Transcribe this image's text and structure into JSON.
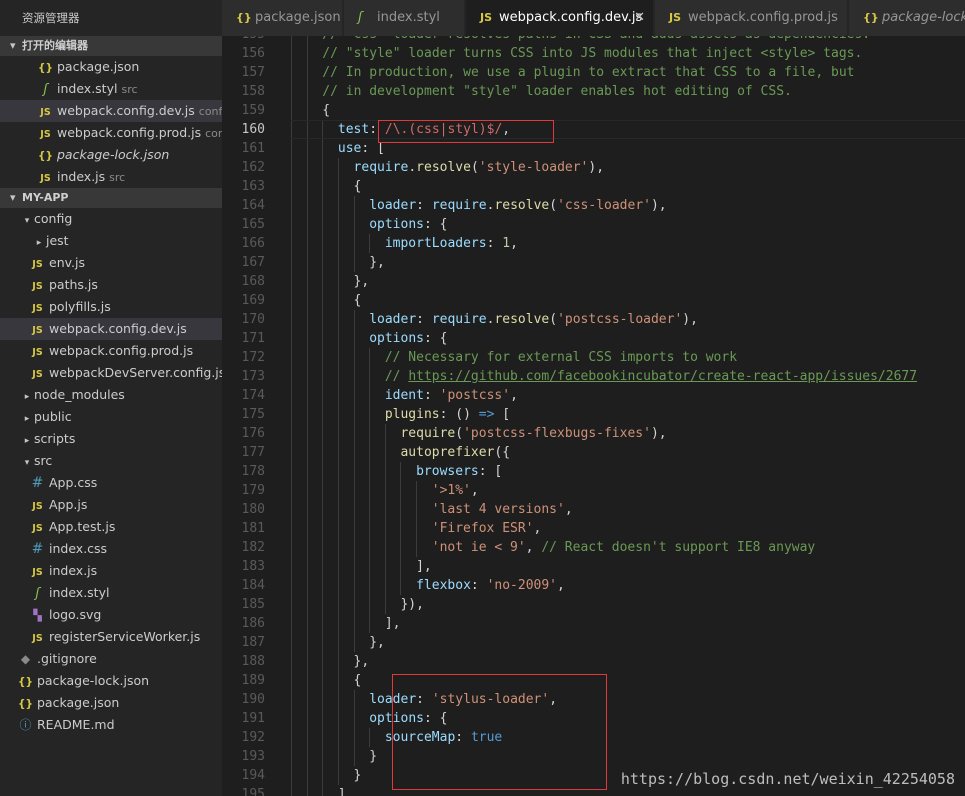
{
  "explorer": {
    "title": "资源管理器",
    "open_editors_label": "打开的编辑器",
    "open_editors": [
      {
        "name": "package.json",
        "icon": "json",
        "desc": "",
        "italic": false,
        "selected": false
      },
      {
        "name": "index.styl",
        "icon": "styl",
        "desc": "src",
        "italic": false,
        "selected": false
      },
      {
        "name": "webpack.config.dev.js",
        "icon": "js",
        "desc": "config",
        "italic": false,
        "selected": true
      },
      {
        "name": "webpack.config.prod.js",
        "icon": "js",
        "desc": "con...",
        "italic": false,
        "selected": false
      },
      {
        "name": "package-lock.json",
        "icon": "json",
        "desc": "",
        "italic": true,
        "selected": false
      },
      {
        "name": "index.js",
        "icon": "js",
        "desc": "src",
        "italic": false,
        "selected": false
      }
    ],
    "project_label": "MY-APP",
    "tree": [
      {
        "name": "config",
        "type": "folder-open",
        "depth": 1
      },
      {
        "name": "jest",
        "type": "folder",
        "depth": 2
      },
      {
        "name": "env.js",
        "type": "js",
        "depth": 2
      },
      {
        "name": "paths.js",
        "type": "js",
        "depth": 2
      },
      {
        "name": "polyfills.js",
        "type": "js",
        "depth": 2
      },
      {
        "name": "webpack.config.dev.js",
        "type": "js",
        "depth": 2,
        "selected": true
      },
      {
        "name": "webpack.config.prod.js",
        "type": "js",
        "depth": 2
      },
      {
        "name": "webpackDevServer.config.js",
        "type": "js",
        "depth": 2
      },
      {
        "name": "node_modules",
        "type": "folder",
        "depth": 1
      },
      {
        "name": "public",
        "type": "folder",
        "depth": 1
      },
      {
        "name": "scripts",
        "type": "folder",
        "depth": 1
      },
      {
        "name": "src",
        "type": "folder-open",
        "depth": 1
      },
      {
        "name": "App.css",
        "type": "css",
        "depth": 2
      },
      {
        "name": "App.js",
        "type": "js",
        "depth": 2
      },
      {
        "name": "App.test.js",
        "type": "js",
        "depth": 2
      },
      {
        "name": "index.css",
        "type": "css",
        "depth": 2
      },
      {
        "name": "index.js",
        "type": "js",
        "depth": 2
      },
      {
        "name": "index.styl",
        "type": "styl",
        "depth": 2
      },
      {
        "name": "logo.svg",
        "type": "svg",
        "depth": 2
      },
      {
        "name": "registerServiceWorker.js",
        "type": "js",
        "depth": 2
      },
      {
        "name": ".gitignore",
        "type": "git",
        "depth": 1
      },
      {
        "name": "package-lock.json",
        "type": "json",
        "depth": 1
      },
      {
        "name": "package.json",
        "type": "json",
        "depth": 1
      },
      {
        "name": "README.md",
        "type": "info",
        "depth": 1
      }
    ]
  },
  "tabs": [
    {
      "label": "package.json",
      "icon": "json",
      "active": false,
      "italic": false
    },
    {
      "label": "index.styl",
      "icon": "styl",
      "active": false,
      "italic": false
    },
    {
      "label": "webpack.config.dev.js",
      "icon": "js",
      "active": true,
      "italic": false
    },
    {
      "label": "webpack.config.prod.js",
      "icon": "js",
      "active": false,
      "italic": false
    },
    {
      "label": "package-lock",
      "icon": "json",
      "active": false,
      "italic": true
    }
  ],
  "icon_glyphs": {
    "js": "JS",
    "json": "{}",
    "styl": "ʃ",
    "css": "#",
    "git": "◆",
    "info": "ⓘ",
    "svg": "▚",
    "close": "✕",
    "collapse": "▾",
    "expand": "▸"
  },
  "editor": {
    "current_line": 160,
    "lines": [
      {
        "num": 155,
        "indent": 2,
        "tokens": [
          [
            "c",
            "// \"css\" loader resolves paths in CSS and adds assets as dependencies."
          ]
        ]
      },
      {
        "num": 156,
        "indent": 2,
        "tokens": [
          [
            "c",
            "// \"style\" loader turns CSS into JS modules that inject <style> tags."
          ]
        ]
      },
      {
        "num": 157,
        "indent": 2,
        "tokens": [
          [
            "c",
            "// In production, we use a plugin to extract that CSS to a file, but"
          ]
        ]
      },
      {
        "num": 158,
        "indent": 2,
        "tokens": [
          [
            "c",
            "// in development \"style\" loader enables hot editing of CSS."
          ]
        ]
      },
      {
        "num": 159,
        "indent": 2,
        "tokens": [
          [
            "p",
            "{"
          ]
        ]
      },
      {
        "num": 160,
        "indent": 3,
        "tokens": [
          [
            "k",
            "test"
          ],
          [
            "p",
            ": "
          ],
          [
            "r",
            "/\\.(css|styl)$/"
          ],
          [
            "p",
            ","
          ]
        ]
      },
      {
        "num": 161,
        "indent": 3,
        "tokens": [
          [
            "k",
            "use"
          ],
          [
            "p",
            ": ["
          ]
        ]
      },
      {
        "num": 162,
        "indent": 4,
        "tokens": [
          [
            "k",
            "require"
          ],
          [
            "p",
            "."
          ],
          [
            "f",
            "resolve"
          ],
          [
            "p",
            "("
          ],
          [
            "s",
            "'style-loader'"
          ],
          [
            "p",
            "),"
          ]
        ]
      },
      {
        "num": 163,
        "indent": 4,
        "tokens": [
          [
            "p",
            "{"
          ]
        ]
      },
      {
        "num": 164,
        "indent": 5,
        "tokens": [
          [
            "k",
            "loader"
          ],
          [
            "p",
            ": "
          ],
          [
            "k",
            "require"
          ],
          [
            "p",
            "."
          ],
          [
            "f",
            "resolve"
          ],
          [
            "p",
            "("
          ],
          [
            "s",
            "'css-loader'"
          ],
          [
            "p",
            "),"
          ]
        ]
      },
      {
        "num": 165,
        "indent": 5,
        "tokens": [
          [
            "k",
            "options"
          ],
          [
            "p",
            ": {"
          ]
        ]
      },
      {
        "num": 166,
        "indent": 6,
        "tokens": [
          [
            "k",
            "importLoaders"
          ],
          [
            "p",
            ": "
          ],
          [
            "n",
            "1"
          ],
          [
            "p",
            ","
          ]
        ]
      },
      {
        "num": 167,
        "indent": 5,
        "tokens": [
          [
            "p",
            "},"
          ]
        ]
      },
      {
        "num": 168,
        "indent": 4,
        "tokens": [
          [
            "p",
            "},"
          ]
        ]
      },
      {
        "num": 169,
        "indent": 4,
        "tokens": [
          [
            "p",
            "{"
          ]
        ]
      },
      {
        "num": 170,
        "indent": 5,
        "tokens": [
          [
            "k",
            "loader"
          ],
          [
            "p",
            ": "
          ],
          [
            "k",
            "require"
          ],
          [
            "p",
            "."
          ],
          [
            "f",
            "resolve"
          ],
          [
            "p",
            "("
          ],
          [
            "s",
            "'postcss-loader'"
          ],
          [
            "p",
            "),"
          ]
        ]
      },
      {
        "num": 171,
        "indent": 5,
        "tokens": [
          [
            "k",
            "options"
          ],
          [
            "p",
            ": {"
          ]
        ]
      },
      {
        "num": 172,
        "indent": 6,
        "tokens": [
          [
            "c",
            "// Necessary for external CSS imports to work"
          ]
        ]
      },
      {
        "num": 173,
        "indent": 6,
        "tokens": [
          [
            "c",
            "// "
          ],
          [
            "l",
            "https://github.com/facebookincubator/create-react-app/issues/2677"
          ]
        ]
      },
      {
        "num": 174,
        "indent": 6,
        "tokens": [
          [
            "k",
            "ident"
          ],
          [
            "p",
            ": "
          ],
          [
            "s",
            "'postcss'"
          ],
          [
            "p",
            ","
          ]
        ]
      },
      {
        "num": 175,
        "indent": 6,
        "tokens": [
          [
            "f",
            "plugins"
          ],
          [
            "p",
            ": () "
          ],
          [
            "b",
            "=>"
          ],
          [
            "p",
            " ["
          ]
        ]
      },
      {
        "num": 176,
        "indent": 7,
        "tokens": [
          [
            "f",
            "require"
          ],
          [
            "p",
            "("
          ],
          [
            "s",
            "'postcss-flexbugs-fixes'"
          ],
          [
            "p",
            "),"
          ]
        ]
      },
      {
        "num": 177,
        "indent": 7,
        "tokens": [
          [
            "f",
            "autoprefixer"
          ],
          [
            "p",
            "({"
          ]
        ]
      },
      {
        "num": 178,
        "indent": 8,
        "tokens": [
          [
            "k",
            "browsers"
          ],
          [
            "p",
            ": ["
          ]
        ]
      },
      {
        "num": 179,
        "indent": 9,
        "tokens": [
          [
            "s",
            "'>1%'"
          ],
          [
            "p",
            ","
          ]
        ]
      },
      {
        "num": 180,
        "indent": 9,
        "tokens": [
          [
            "s",
            "'last 4 versions'"
          ],
          [
            "p",
            ","
          ]
        ]
      },
      {
        "num": 181,
        "indent": 9,
        "tokens": [
          [
            "s",
            "'Firefox ESR'"
          ],
          [
            "p",
            ","
          ]
        ]
      },
      {
        "num": 182,
        "indent": 9,
        "tokens": [
          [
            "s",
            "'not ie < 9'"
          ],
          [
            "p",
            ", "
          ],
          [
            "c",
            "// React doesn't support IE8 anyway"
          ]
        ]
      },
      {
        "num": 183,
        "indent": 8,
        "tokens": [
          [
            "p",
            "],"
          ]
        ]
      },
      {
        "num": 184,
        "indent": 8,
        "tokens": [
          [
            "k",
            "flexbox"
          ],
          [
            "p",
            ": "
          ],
          [
            "s",
            "'no-2009'"
          ],
          [
            "p",
            ","
          ]
        ]
      },
      {
        "num": 185,
        "indent": 7,
        "tokens": [
          [
            "p",
            "}),"
          ]
        ]
      },
      {
        "num": 186,
        "indent": 6,
        "tokens": [
          [
            "p",
            "],"
          ]
        ]
      },
      {
        "num": 187,
        "indent": 5,
        "tokens": [
          [
            "p",
            "},"
          ]
        ]
      },
      {
        "num": 188,
        "indent": 4,
        "tokens": [
          [
            "p",
            "},"
          ]
        ]
      },
      {
        "num": 189,
        "indent": 4,
        "tokens": [
          [
            "p",
            "{"
          ]
        ]
      },
      {
        "num": 190,
        "indent": 5,
        "tokens": [
          [
            "k",
            "loader"
          ],
          [
            "p",
            ": "
          ],
          [
            "s",
            "'stylus-loader'"
          ],
          [
            "p",
            ","
          ]
        ]
      },
      {
        "num": 191,
        "indent": 5,
        "tokens": [
          [
            "k",
            "options"
          ],
          [
            "p",
            ": {"
          ]
        ]
      },
      {
        "num": 192,
        "indent": 6,
        "tokens": [
          [
            "k",
            "sourceMap"
          ],
          [
            "p",
            ": "
          ],
          [
            "b",
            "true"
          ]
        ]
      },
      {
        "num": 193,
        "indent": 5,
        "tokens": [
          [
            "p",
            "}"
          ]
        ]
      },
      {
        "num": 194,
        "indent": 4,
        "tokens": [
          [
            "p",
            "}"
          ]
        ]
      },
      {
        "num": 195,
        "indent": 3,
        "tokens": [
          [
            "p",
            "],"
          ]
        ]
      }
    ]
  },
  "watermark": "https://blog.csdn.net/weixin_42254058"
}
